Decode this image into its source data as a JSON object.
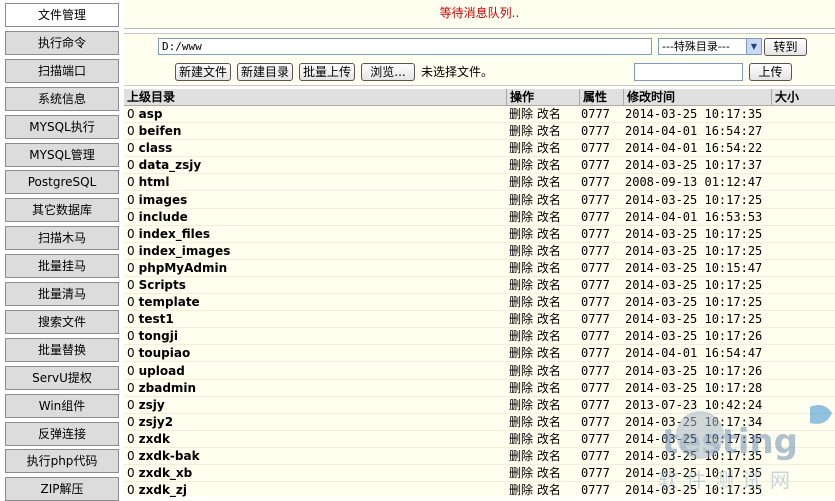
{
  "message": "等待消息队列..",
  "sidebar": {
    "items": [
      {
        "label": "文件管理",
        "active": true
      },
      {
        "label": "执行命令"
      },
      {
        "label": "扫描端口"
      },
      {
        "label": "系统信息"
      },
      {
        "label": "MYSQL执行"
      },
      {
        "label": "MYSQL管理"
      },
      {
        "label": "PostgreSQL"
      },
      {
        "label": "其它数据库"
      },
      {
        "label": "扫描木马"
      },
      {
        "label": "批量挂马"
      },
      {
        "label": "批量清马"
      },
      {
        "label": "搜索文件"
      },
      {
        "label": "批量替换"
      },
      {
        "label": "ServU提权"
      },
      {
        "label": "Win组件"
      },
      {
        "label": "反弹连接"
      },
      {
        "label": "执行php代码"
      },
      {
        "label": "ZIP解压"
      }
    ]
  },
  "toolbar": {
    "path_value": "D:/www",
    "special_dir_label": "---特殊目录---",
    "goto_label": "转到",
    "new_file_label": "新建文件",
    "new_dir_label": "新建目录",
    "batch_upload_label": "批量上传",
    "browse_label": "浏览...",
    "no_file_label": "未选择文件。",
    "upload_label": "上传"
  },
  "table": {
    "headers": {
      "name": "上级目录",
      "ops": "操作",
      "attr": "属性",
      "time": "修改时间",
      "size": "大小"
    },
    "rows": [
      {
        "idx": "0",
        "name": "asp",
        "del": "删除",
        "ren": "改名",
        "attr": "0777",
        "time": "2014-03-25 10:17:35"
      },
      {
        "idx": "0",
        "name": "beifen",
        "del": "删除",
        "ren": "改名",
        "attr": "0777",
        "time": "2014-04-01 16:54:27"
      },
      {
        "idx": "0",
        "name": "class",
        "del": "删除",
        "ren": "改名",
        "attr": "0777",
        "time": "2014-04-01 16:54:22"
      },
      {
        "idx": "0",
        "name": "data_zsjy",
        "del": "删除",
        "ren": "改名",
        "attr": "0777",
        "time": "2014-03-25 10:17:37"
      },
      {
        "idx": "0",
        "name": "html",
        "del": "删除",
        "ren": "改名",
        "attr": "0777",
        "time": "2008-09-13 01:12:47"
      },
      {
        "idx": "0",
        "name": "images",
        "del": "删除",
        "ren": "改名",
        "attr": "0777",
        "time": "2014-03-25 10:17:25"
      },
      {
        "idx": "0",
        "name": "include",
        "del": "删除",
        "ren": "改名",
        "attr": "0777",
        "time": "2014-04-01 16:53:53"
      },
      {
        "idx": "0",
        "name": "index_files",
        "del": "删除",
        "ren": "改名",
        "attr": "0777",
        "time": "2014-03-25 10:17:25"
      },
      {
        "idx": "0",
        "name": "index_images",
        "del": "删除",
        "ren": "改名",
        "attr": "0777",
        "time": "2014-03-25 10:17:25"
      },
      {
        "idx": "0",
        "name": "phpMyAdmin",
        "del": "删除",
        "ren": "改名",
        "attr": "0777",
        "time": "2014-03-25 10:15:47"
      },
      {
        "idx": "0",
        "name": "Scripts",
        "del": "删除",
        "ren": "改名",
        "attr": "0777",
        "time": "2014-03-25 10:17:25"
      },
      {
        "idx": "0",
        "name": "template",
        "del": "删除",
        "ren": "改名",
        "attr": "0777",
        "time": "2014-03-25 10:17:25"
      },
      {
        "idx": "0",
        "name": "test1",
        "del": "删除",
        "ren": "改名",
        "attr": "0777",
        "time": "2014-03-25 10:17:25"
      },
      {
        "idx": "0",
        "name": "tongji",
        "del": "删除",
        "ren": "改名",
        "attr": "0777",
        "time": "2014-03-25 10:17:26"
      },
      {
        "idx": "0",
        "name": "toupiao",
        "del": "删除",
        "ren": "改名",
        "attr": "0777",
        "time": "2014-04-01 16:54:47"
      },
      {
        "idx": "0",
        "name": "upload",
        "del": "删除",
        "ren": "改名",
        "attr": "0777",
        "time": "2014-03-25 10:17:26"
      },
      {
        "idx": "0",
        "name": "zbadmin",
        "del": "删除",
        "ren": "改名",
        "attr": "0777",
        "time": "2014-03-25 10:17:28"
      },
      {
        "idx": "0",
        "name": "zsjy",
        "del": "删除",
        "ren": "改名",
        "attr": "0777",
        "time": "2013-07-23 10:42:24"
      },
      {
        "idx": "0",
        "name": "zsjy2",
        "del": "删除",
        "ren": "改名",
        "attr": "0777",
        "time": "2014-03-25 10:17:34"
      },
      {
        "idx": "0",
        "name": "zxdk",
        "del": "删除",
        "ren": "改名",
        "attr": "0777",
        "time": "2014-03-25 10:17:35"
      },
      {
        "idx": "0",
        "name": "zxdk-bak",
        "del": "删除",
        "ren": "改名",
        "attr": "0777",
        "time": "2014-03-25 10:17:35"
      },
      {
        "idx": "0",
        "name": "zxdk_xb",
        "del": "删除",
        "ren": "改名",
        "attr": "0777",
        "time": "2014-03-25 10:17:35"
      },
      {
        "idx": "0",
        "name": "zxdk_zj",
        "del": "删除",
        "ren": "改名",
        "attr": "0777",
        "time": "2014-03-25 10:17:35"
      }
    ]
  },
  "watermark": {
    "brand": "testing",
    "cn": "软件测试网"
  },
  "colors": {
    "accent_red": "#cc0000",
    "panel_bg": "#fffff0",
    "nav_bg": "#dcdcdc",
    "header_bg": "#e0e0e0"
  }
}
